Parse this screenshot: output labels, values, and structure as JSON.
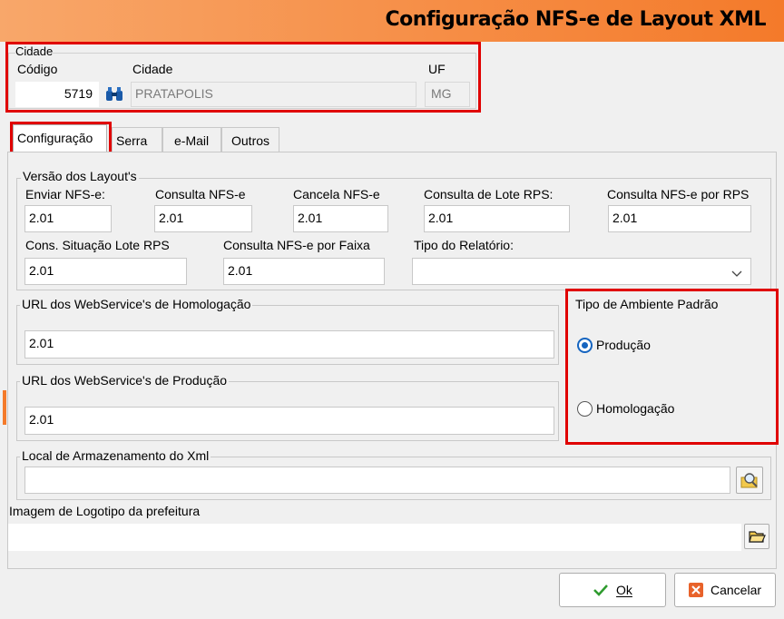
{
  "window": {
    "title": "Configuração NFS-e de Layout XML"
  },
  "cidade": {
    "group_label": "Cidade",
    "codigo_label": "Código",
    "codigo_value": "5719",
    "cidade_label": "Cidade",
    "cidade_value": "PRATAPOLIS",
    "uf_label": "UF",
    "uf_value": "MG"
  },
  "tabs": [
    {
      "label": "Configuração"
    },
    {
      "label": "Serra"
    },
    {
      "label": "e-Mail"
    },
    {
      "label": "Outros"
    }
  ],
  "versoes": {
    "group_label": "Versão dos Layout's",
    "fields": [
      {
        "label": "Enviar NFS-e:",
        "value": "2.01"
      },
      {
        "label": "Consulta NFS-e",
        "value": "2.01"
      },
      {
        "label": "Cancela NFS-e",
        "value": "2.01"
      },
      {
        "label": "Consulta de Lote RPS:",
        "value": "2.01"
      },
      {
        "label": "Consulta NFS-e por RPS",
        "value": "2.01"
      },
      {
        "label": "Cons. Situação Lote RPS",
        "value": "2.01"
      },
      {
        "label": "Consulta NFS-e por Faixa",
        "value": "2.01"
      }
    ],
    "tipo_relatorio_label": "Tipo do Relatório:",
    "tipo_relatorio_value": ""
  },
  "url_homologacao": {
    "label": "URL dos WebService's de Homologação",
    "value": "2.01"
  },
  "url_producao": {
    "label": "URL dos WebService's de Produção",
    "value": "2.01"
  },
  "ambiente": {
    "label": "Tipo de Ambiente Padrão",
    "options": [
      {
        "label": "Produção",
        "selected": true
      },
      {
        "label": "Homologação",
        "selected": false
      }
    ]
  },
  "local_xml": {
    "label": "Local de Armazenamento do Xml",
    "value": ""
  },
  "logotipo": {
    "label": "Imagem de Logotipo da prefeitura",
    "value": ""
  },
  "buttons": {
    "ok": "Ok",
    "cancelar": "Cancelar"
  },
  "colors": {
    "header_start": "#f8a76a",
    "header_end": "#f47a2a",
    "highlight": "#e00000",
    "radio_accent": "#1665c0"
  }
}
